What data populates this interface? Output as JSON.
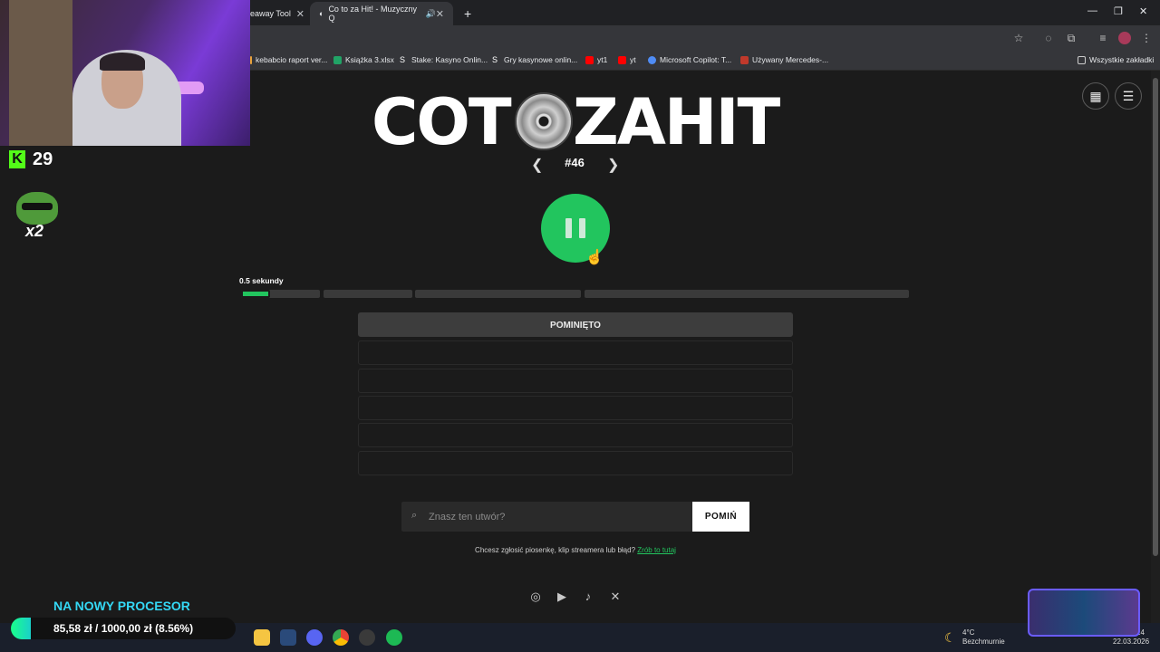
{
  "browser": {
    "tabs": [
      {
        "title": "eaway Tool",
        "active": false
      },
      {
        "title": "Co to za Hit! - Muzyczny Q",
        "active": true
      }
    ],
    "new_tab": "+",
    "bookmarks": [
      {
        "label": "kebabcio raport ver...",
        "color": "#e8a33a"
      },
      {
        "label": "Książka 3.xlsx",
        "color": "#21a366"
      },
      {
        "label": "Stake: Kasyno Onlin...",
        "color": "#ffffff"
      },
      {
        "label": "Gry kasynowe onlin...",
        "color": "#ffffff"
      },
      {
        "label": "yt1",
        "color": "#ff0000"
      },
      {
        "label": "yt",
        "color": "#ff0000"
      },
      {
        "label": "Microsoft Copilot: T...",
        "color": "#4f8cf5"
      },
      {
        "label": "Używany Mercedes-...",
        "color": "#c0392b"
      }
    ],
    "all_bookmarks": "Wszystkie zakładki"
  },
  "game": {
    "logo_left": "COT",
    "logo_right": "ZAHIT",
    "round": "#46",
    "seconds_label": "0.5 sekundy",
    "progress_fraction": 0.04,
    "skipped_label": "POMINIĘTO",
    "search_placeholder": "Znasz ten utwór?",
    "skip_button": "POMIŃ",
    "report_text": "Chcesz zgłosić piosenkę, klip streamera lub błąd?",
    "report_link": "Zrób to tutaj"
  },
  "overlay": {
    "viewer_count": "29",
    "multiplier": "x2",
    "goal_title": "NA NOWY PROCESOR",
    "goal_text": "85,58 zł / 1000,00 zł (8.56%)",
    "goal_fraction": 0.0856
  },
  "taskbar": {
    "weather_temp": "4°C",
    "weather_desc": "Bezchmurnie",
    "clock": "24",
    "date": "22.03.2026"
  },
  "colors": {
    "accent": "#22c55e",
    "background": "#1b1b1b",
    "kick": "#53fc18"
  }
}
